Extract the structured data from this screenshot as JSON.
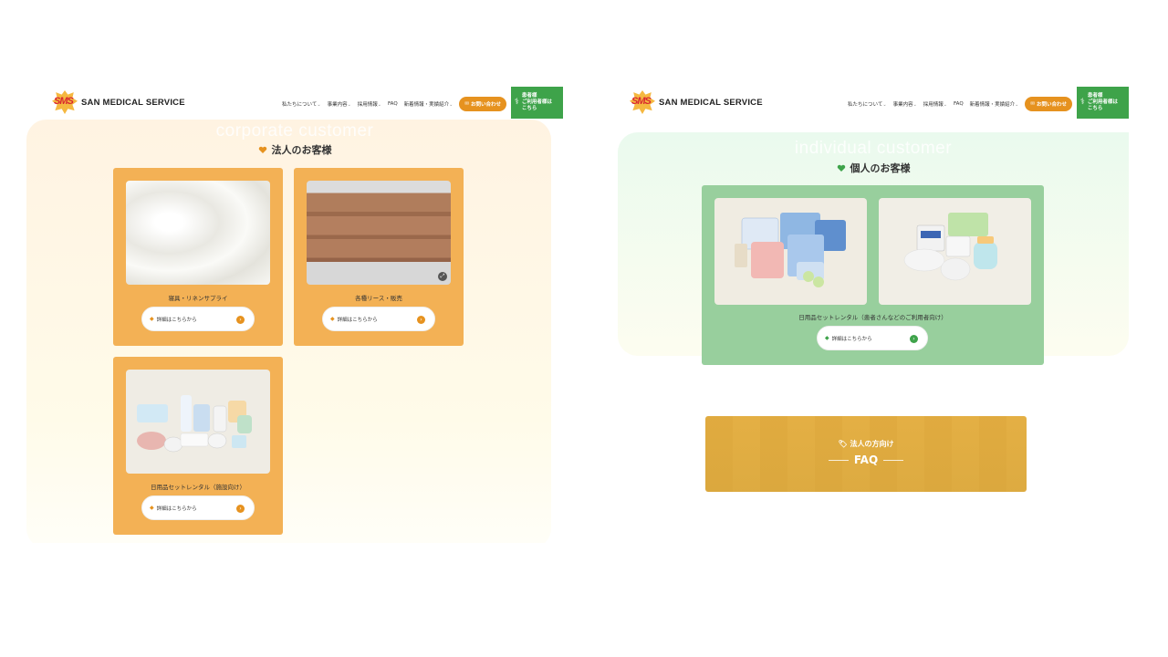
{
  "site": {
    "logo_mark": "SMS",
    "logo_name": "SAN MEDICAL SERVICE"
  },
  "nav": {
    "items": [
      "私たちについて",
      "事業内容",
      "採用情報",
      "FAQ",
      "新着情報・実績紹介"
    ],
    "contact_label": "お問い合わせ",
    "patient_label_1": "患者様",
    "patient_label_2": "ご利用者様は",
    "patient_label_3": "こちら"
  },
  "corporate": {
    "en_title": "corporate customer",
    "jp_title": "法人のお客様",
    "cards": [
      {
        "label": "寝具・リネンサプライ",
        "button": "詳細はこちらから"
      },
      {
        "label": "各種リース・販売",
        "button": "詳細はこちらから"
      },
      {
        "label": "日用品セットレンタル（施設向け）",
        "button": "詳細はこちらから"
      }
    ]
  },
  "individual": {
    "en_title": "individual customer",
    "jp_title": "個人のお客様",
    "card_label": "日用品セットレンタル（患者さんなどのご利用者向け）",
    "button": "詳細はこちらから"
  },
  "faq": {
    "sub": "法人の方向け",
    "title": "FAQ"
  },
  "colors": {
    "orange": "#e6921f",
    "card_orange": "#f3b155",
    "green": "#3ea34a",
    "card_green": "#98cf9d"
  },
  "icons": [
    "heart-icon",
    "tag-icon",
    "arrow-right-icon",
    "mail-icon",
    "patient-icon",
    "zoom-icon"
  ]
}
